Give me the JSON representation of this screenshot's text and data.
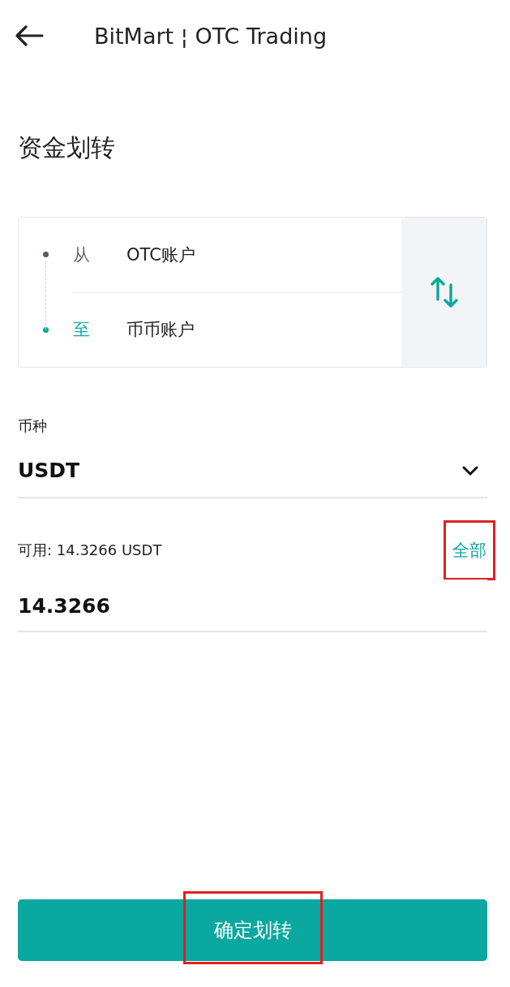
{
  "header": {
    "title": "BitMart ¦ OTC Trading"
  },
  "page_title": "资金划转",
  "transfer": {
    "from": {
      "label": "从",
      "account": "OTC账户"
    },
    "to": {
      "label": "至",
      "account": "币币账户"
    }
  },
  "currency": {
    "label": "币种",
    "value": "USDT"
  },
  "amount": {
    "available": "可用: 14.3266 USDT",
    "all_link": {
      "text": "全部",
      "highlighted": true
    },
    "value": "14.3266"
  },
  "confirm_button": {
    "text": "确定划转",
    "highlighted": true
  }
}
